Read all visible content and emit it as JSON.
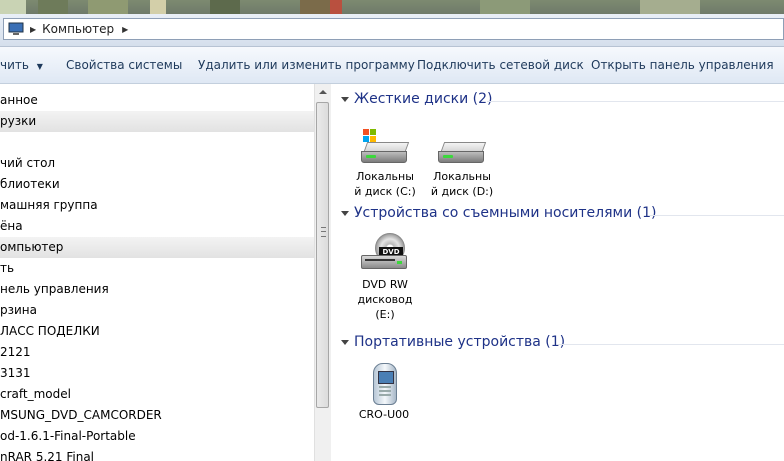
{
  "address_bar": {
    "crumb": "Компьютер",
    "icons": [
      "computer-icon",
      "breadcrumb-arrow-icon",
      "breadcrumb-chevron-icon"
    ]
  },
  "toolbar": {
    "organize": "чить",
    "system_properties": "Свойства системы",
    "uninstall": "Удалить или изменить программу",
    "map_drive": "Подключить сетевой диск",
    "control_panel": "Открыть панель управления"
  },
  "nav": {
    "items": [
      {
        "label": "анное",
        "selected": false
      },
      {
        "label": "рузки",
        "selected": true
      },
      {
        "label": "",
        "selected": false
      },
      {
        "label": "чий стол",
        "selected": false
      },
      {
        "label": "блиотеки",
        "selected": false
      },
      {
        "label": "машняя группа",
        "selected": false
      },
      {
        "label": "ёна",
        "selected": false
      },
      {
        "label": "омпьютер",
        "selected": true
      },
      {
        "label": "ть",
        "selected": false
      },
      {
        "label": "нель управления",
        "selected": false
      },
      {
        "label": "рзина",
        "selected": false
      },
      {
        "label": "ЛАСС ПОДЕЛКИ",
        "selected": false
      },
      {
        "label": "2121",
        "selected": false
      },
      {
        "label": "3131",
        "selected": false
      },
      {
        "label": "craft_model",
        "selected": false
      },
      {
        "label": "MSUNG_DVD_CAMCORDER",
        "selected": false
      },
      {
        "label": "od-1.6.1-Final-Portable",
        "selected": false
      },
      {
        "label": "nRAR 5.21 Final",
        "selected": false
      }
    ]
  },
  "groups": [
    {
      "title": "Жесткие диски (2)",
      "items": [
        {
          "label1": "Локальны",
          "label2": "й диск (C:)",
          "icon": "windows-drive-icon"
        },
        {
          "label1": "Локальны",
          "label2": "й диск (D:)",
          "icon": "hard-drive-icon"
        }
      ]
    },
    {
      "title": "Устройства со съемными носителями (1)",
      "items": [
        {
          "label1": "DVD RW",
          "label2": "дисковод",
          "label3": "(E:)",
          "icon_text": "DVD",
          "icon": "dvd-drive-icon"
        }
      ]
    },
    {
      "title": "Портативные устройства (1)",
      "items": [
        {
          "label1": "CRO-U00",
          "icon": "portable-phone-icon"
        }
      ]
    }
  ],
  "colors": {
    "group_title": "#1e3287",
    "toolbar_text": "#1e395b"
  }
}
